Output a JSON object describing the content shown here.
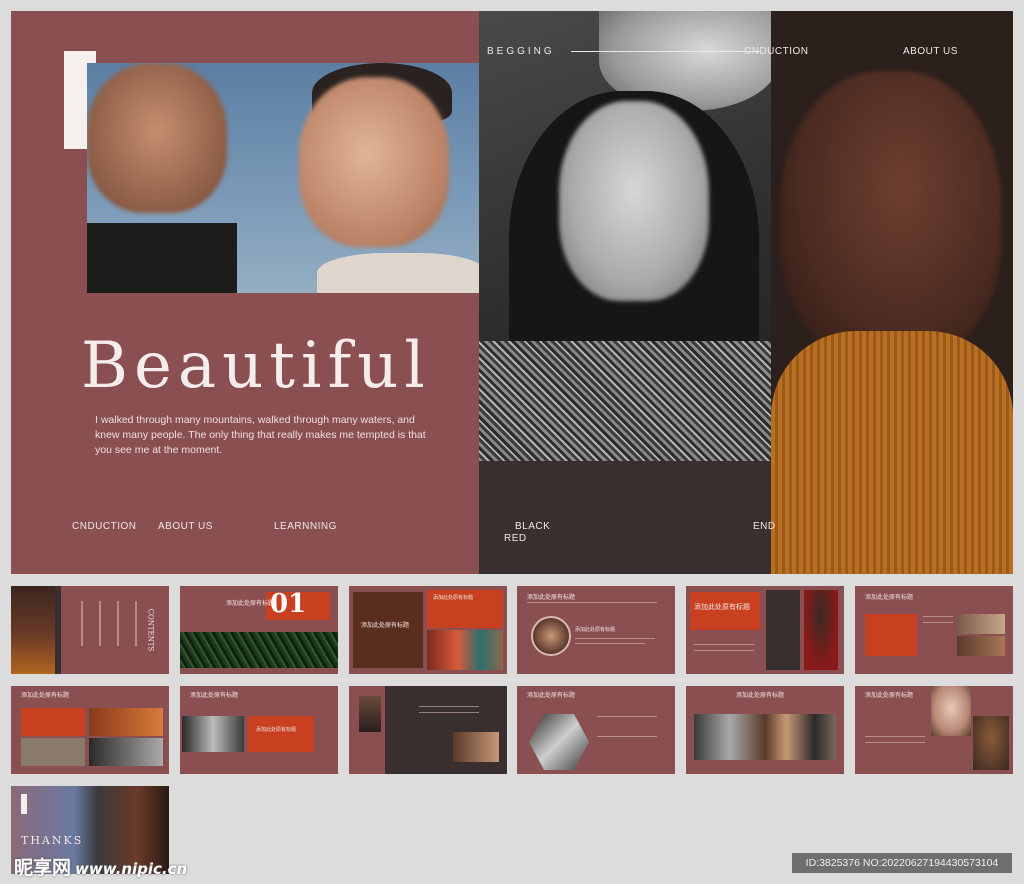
{
  "main_slide": {
    "nav_top": [
      "BEGGING",
      "CNDUCTION",
      "ABOUT US"
    ],
    "headline": "Beautiful",
    "paragraph_lines": [
      "I walked through many mountains, walked through many waters, and",
      "knew many people. The only thing that really makes me tempted is that",
      "you see me at the moment."
    ],
    "nav_bottom": [
      "CNDUCTION",
      "ABOUT US",
      "LEARNNING"
    ],
    "black_label": "BLACK",
    "red_label": "RED",
    "end_label": "END"
  },
  "thumbnails": [
    {
      "vertical_title": "CONTENTS",
      "vertical_sub": "目录"
    },
    {
      "number": "01",
      "title": "添加此处原有标题"
    },
    {
      "title": "添加此处原有标题",
      "small": "添加此处原有标题"
    },
    {
      "title": "添加此处原有标题",
      "small": "添加此处原有标题"
    },
    {
      "title": "添加此处原有标题"
    },
    {
      "title": "添加此处原有标题"
    },
    {
      "title": "添加此处原有标题"
    },
    {
      "title": "添加此处原有标题",
      "small": "添加此处原有标题"
    },
    {
      "title": "添加此处原有标题"
    },
    {
      "title": "添加此处原有标题"
    },
    {
      "title": "添加此处原有标题"
    },
    {
      "title": "添加此处原有标题"
    },
    {
      "title": "THANKS"
    }
  ],
  "watermark": {
    "brand": "昵享网",
    "site": "www.nipic.cn",
    "id_text": "ID:3825376 NO:20220627194430573104"
  },
  "colors": {
    "slide_bg": "#894f51",
    "accent": "#c8401f",
    "dark": "#3a2f2f",
    "page_bg": "#dcdcdc"
  }
}
